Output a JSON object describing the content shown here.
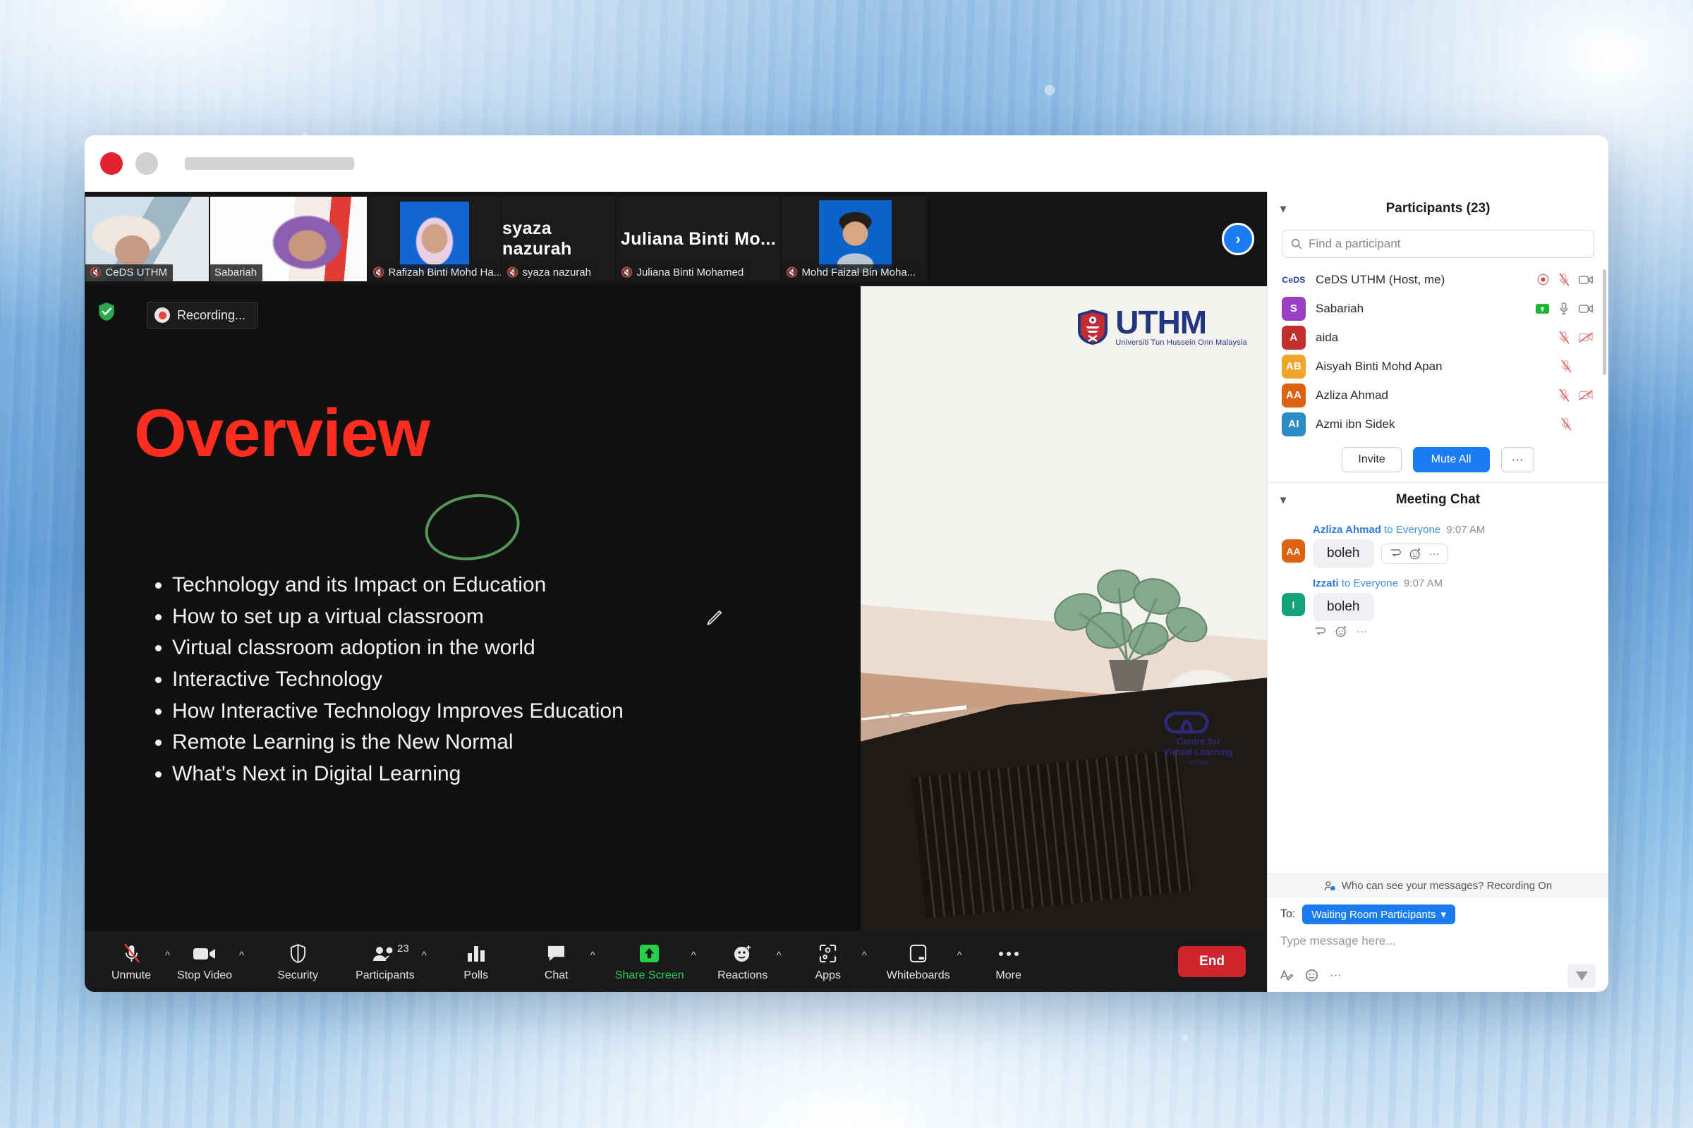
{
  "window": {
    "traffic_lights": [
      "close",
      "minimize"
    ],
    "url_placeholder": ""
  },
  "filmstrip": {
    "next_label": "›",
    "thumbnails": [
      {
        "name": "CeDS UTHM",
        "display": "",
        "muted": true,
        "active": false,
        "style": "cam-a"
      },
      {
        "name": "Sabariah",
        "display": "",
        "muted": false,
        "active": true,
        "style": "cam-b"
      },
      {
        "name": "Rafizah Binti Mohd Ha...",
        "display": "",
        "muted": true,
        "active": false,
        "style": "cam-photo-blue"
      },
      {
        "name": "syaza nazurah",
        "display": "syaza nazurah",
        "muted": true,
        "active": false,
        "style": ""
      },
      {
        "name": "Juliana Binti Mohamed",
        "display": "Juliana  Binti  Mo...",
        "muted": true,
        "active": false,
        "style": ""
      },
      {
        "name": "Mohd Faizal Bin Moha...",
        "display": "",
        "muted": true,
        "active": false,
        "style": "cam-photo-blue2"
      }
    ]
  },
  "stage": {
    "recording_label": "Recording...",
    "slide": {
      "title": "Overview",
      "bullets": [
        "Technology and its Impact on Education",
        "How to set up a virtual classroom",
        "Virtual classroom adoption in the world",
        "Interactive Technology",
        "How Interactive Technology Improves Education",
        "Remote Learning is the New Normal",
        "What's Next in Digital Learning"
      ],
      "title_color": "#ff2d20"
    },
    "camera": {
      "uthm_logo_text": "UTHM",
      "uthm_logo_sub": "Universiti Tun Hussein Onn Malaysia",
      "cvl_line1": "Centre for",
      "cvl_line2": "Virtual Learning",
      "cvl_line3": "UTHM"
    }
  },
  "toolbar": {
    "items": [
      {
        "label": "Unmute",
        "icon": "mic-off-icon",
        "caret": true,
        "green": false,
        "badge": ""
      },
      {
        "label": "Stop Video",
        "icon": "video-icon",
        "caret": true,
        "green": false,
        "badge": ""
      },
      {
        "label": "Security",
        "icon": "shield-icon",
        "caret": false,
        "green": false,
        "badge": ""
      },
      {
        "label": "Participants",
        "icon": "participants-icon",
        "caret": true,
        "green": false,
        "badge": "23"
      },
      {
        "label": "Polls",
        "icon": "polls-icon",
        "caret": false,
        "green": false,
        "badge": ""
      },
      {
        "label": "Chat",
        "icon": "chat-icon",
        "caret": true,
        "green": false,
        "badge": ""
      },
      {
        "label": "Share Screen",
        "icon": "share-screen-icon",
        "caret": true,
        "green": true,
        "badge": ""
      },
      {
        "label": "Reactions",
        "icon": "reactions-icon",
        "caret": true,
        "green": false,
        "badge": ""
      },
      {
        "label": "Apps",
        "icon": "apps-icon",
        "caret": true,
        "green": false,
        "badge": ""
      },
      {
        "label": "Whiteboards",
        "icon": "whiteboard-icon",
        "caret": true,
        "green": false,
        "badge": ""
      },
      {
        "label": "More",
        "icon": "more-dots-icon",
        "caret": false,
        "green": false,
        "badge": ""
      }
    ],
    "end_label": "End",
    "end_color": "#d0252c"
  },
  "participants_panel": {
    "title": "Participants (23)",
    "search_placeholder": "Find a participant",
    "rows": [
      {
        "initials": "CeDS",
        "name": "CeDS UTHM (Host, me)",
        "color": "#ffffff",
        "logo": true,
        "icons": [
          "record-icon",
          "mic-off-icon",
          "video-on-icon"
        ]
      },
      {
        "initials": "S",
        "name": "Sabariah",
        "color": "#9b3fc4",
        "logo": false,
        "icons": [
          "share-green-icon",
          "mic-on-icon",
          "video-on-icon"
        ]
      },
      {
        "initials": "A",
        "name": "aida",
        "color": "#c12f2f",
        "logo": false,
        "icons": [
          "mic-off-icon",
          "video-off-icon"
        ]
      },
      {
        "initials": "AB",
        "name": "Aisyah Binti Mohd Apan",
        "color": "#f0a62b",
        "logo": false,
        "icons": [
          "mic-off-icon"
        ]
      },
      {
        "initials": "AA",
        "name": "Azliza Ahmad",
        "color": "#dd6212",
        "logo": false,
        "icons": [
          "mic-off-icon",
          "video-off-icon"
        ]
      },
      {
        "initials": "AI",
        "name": "Azmi ibn Sidek",
        "color": "#2b8cc4",
        "logo": false,
        "icons": [
          "mic-off-icon"
        ]
      }
    ],
    "buttons": {
      "invite": "Invite",
      "mute_all": "Mute All",
      "more": "···"
    }
  },
  "chat_panel": {
    "title": "Meeting Chat",
    "messages": [
      {
        "sender": "Azliza Ahmad",
        "to": "to Everyone",
        "time": "9:07 AM",
        "text": "boleh",
        "initials": "AA",
        "color": "#dd6212",
        "reactions_inline": true
      },
      {
        "sender": "Izzati",
        "to": "to Everyone",
        "time": "9:07 AM",
        "text": "boleh",
        "initials": "I",
        "color": "#12a37a",
        "reactions_inline": false
      }
    ],
    "privacy_note": "Who can see your messages? Recording On",
    "to_label": "To:",
    "to_value": "Waiting Room Participants",
    "input_placeholder": "Type message here...",
    "accent": "#1a7cf0"
  }
}
